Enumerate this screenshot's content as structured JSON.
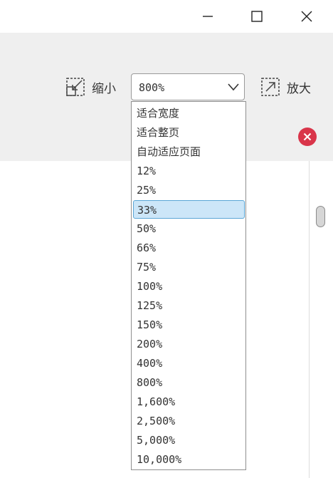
{
  "toolbar": {
    "zoom_out_label": "缩小",
    "zoom_in_label": "放大",
    "zoom_value": "800%"
  },
  "dropdown": {
    "options": [
      "适合宽度",
      "适合整页",
      "自动适应页面",
      "12%",
      "25%",
      "33%",
      "50%",
      "66%",
      "75%",
      "100%",
      "125%",
      "150%",
      "200%",
      "400%",
      "800%",
      "1,600%",
      "2,500%",
      "5,000%",
      "10,000%"
    ],
    "highlighted": "33%"
  },
  "icons": {
    "minimize": "minimize-icon",
    "maximize": "maximize-icon",
    "close": "close-icon",
    "zoom_out": "zoom-out-icon",
    "zoom_in": "zoom-in-icon",
    "dropdown_arrow": "chevron-down-icon",
    "error_close": "close-circle-icon"
  },
  "colors": {
    "toolbar_bg": "#efefef",
    "selection_bg": "#cce6f8",
    "selection_border": "#5aa6d6",
    "close_circle": "#d9354a"
  }
}
